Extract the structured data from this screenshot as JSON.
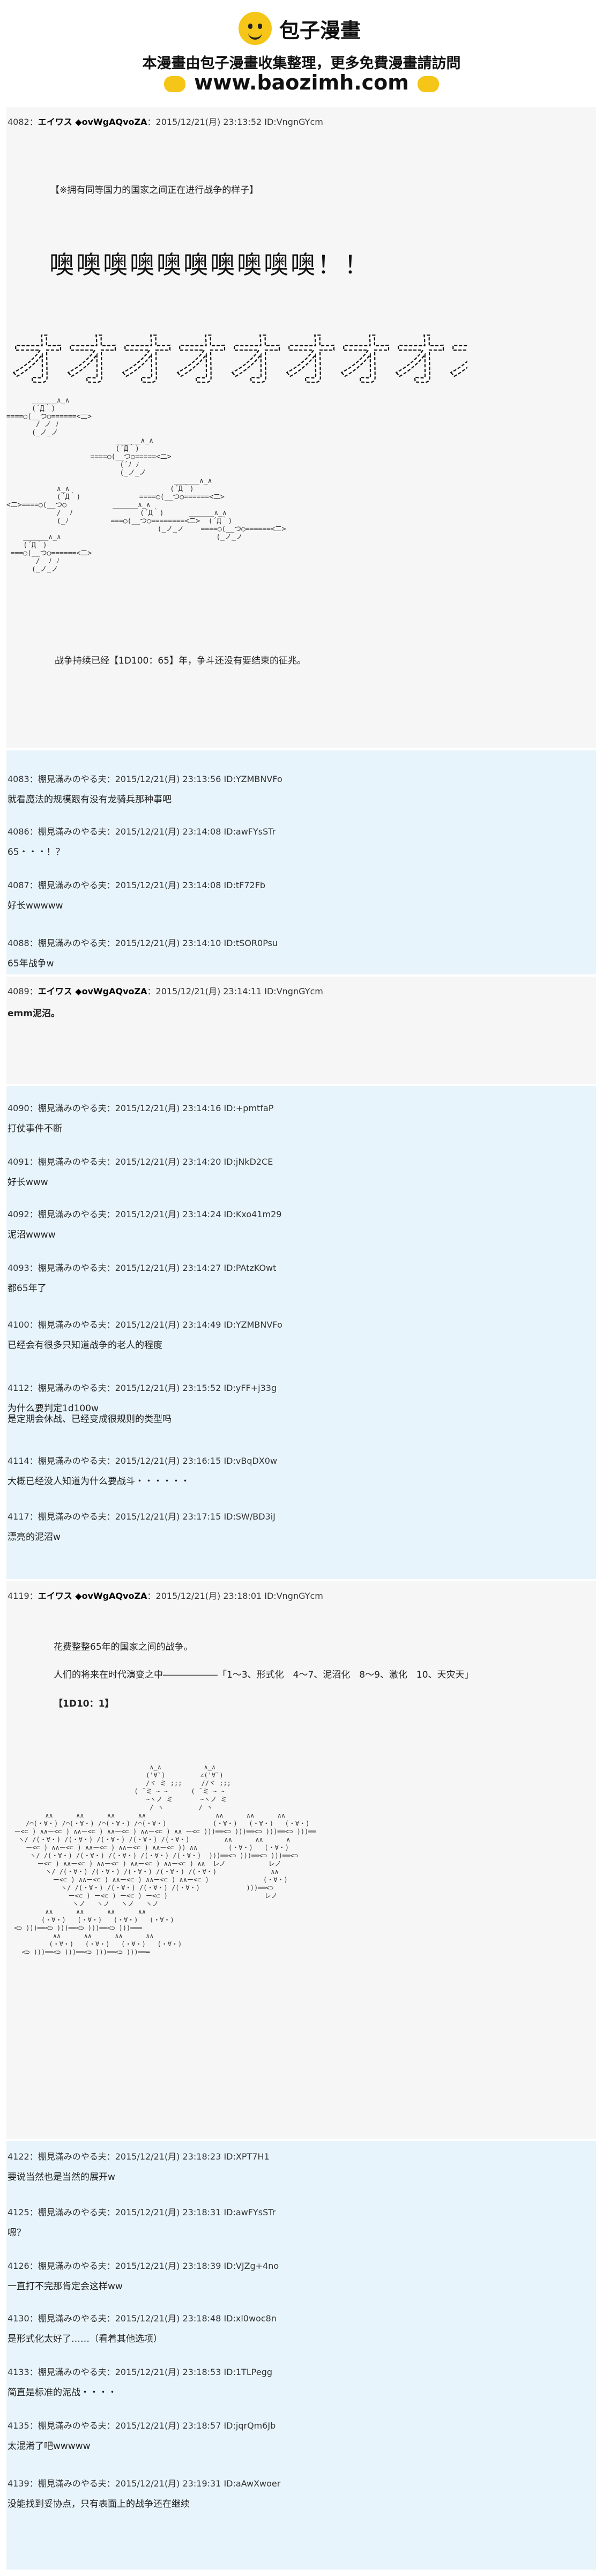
{
  "header": {
    "logo_text": "包子漫畫",
    "tagline": "本漫畫由包子漫畫收集整理，更多免費漫畫請訪問",
    "url": "www.baozimh.com"
  },
  "post4082": {
    "num": "4082",
    "name": "エイワス ◆ovWgAQvoZA",
    "meta_rest": "：2015/12/21(月) 23:13:52 ID:VngnGYcm",
    "line1": "【※拥有同等国力的国家之间正在进行战争的样子】",
    "big": "噢噢噢噢噢噢噢噢噢噢！！",
    "katakana": "オオオオオオオオオオ!!",
    "line_last": "战争持续已经【1D100：65】年，争斗还没有要结束的征兆。"
  },
  "aa1": [
    "      ______∧_∧",
    "      (´Д｀)",
    "====○(__つ○======<二>",
    "       / ノ ﾉ",
    "      (_ノ_ノ",
    "                          ______∧_∧",
    "                          (´Д｀)",
    "                    ====○(__つ○=====<二>",
    "                           (´ﾉ ﾉ",
    "                           (_ノ_ノ",
    "                                        ______∧_∧",
    "            ∧_∧                        (´Д｀)",
    "            (´Д｀)              ====○(__つ○======<二>",
    "<二>====○(__つ○           ______∧_∧",
    "            /  ﾉ                (´Д｀)      ______∧_∧",
    "            (_ﾉ          ===○(__つ○========<二>  (´Д｀)",
    "                                    (_ノ_ノ    ====○(__つ○======<二>",
    "    ______∧_∧                                     (_ノ_ノ",
    "    (´Д｀)",
    " ===○(__つ○======<二>",
    "       /  ﾉ ﾉ",
    "      (_ノ_ノ"
  ],
  "posts_a": [
    {
      "num": "4083",
      "meta": "：棚見滿みのやる夫：2015/12/21(月) 23:13:56 ID:YZMBNVFo",
      "text": "就看魔法的规模跟有没有龙骑兵那种事吧"
    },
    {
      "num": "4086",
      "meta": "：棚見滿みのやる夫：2015/12/21(月) 23:14:08 ID:awFYsSTr",
      "text": "65・・・！？"
    },
    {
      "num": "4087",
      "meta": "：棚見滿みのやる夫：2015/12/21(月) 23:14:08 ID:tF72Fb",
      "text": "好长wwwww"
    },
    {
      "num": "4088",
      "meta": "：棚見滿みのやる夫：2015/12/21(月) 23:14:10 ID:tSOR0Psu",
      "text": "65年战争w"
    }
  ],
  "post4089": {
    "num": "4089",
    "name": "エイワス ◆ovWgAQvoZA",
    "meta_rest": "：2015/12/21(月) 23:14:11 ID:VngnGYcm",
    "text": "emm泥沼。"
  },
  "posts_b": [
    {
      "num": "4090",
      "meta": "：棚見滿みのやる夫：2015/12/21(月) 23:14:16 ID:+pmtfaP",
      "text": "打仗事件不断"
    },
    {
      "num": "4091",
      "meta": "：棚見滿みのやる夫：2015/12/21(月) 23:14:20 ID:jNkD2CE",
      "text": "好长www"
    },
    {
      "num": "4092",
      "meta": "：棚見滿みのやる夫：2015/12/21(月) 23:14:24 ID:Kxo41m29",
      "text": "泥沼wwww"
    },
    {
      "num": "4093",
      "meta": "：棚見滿みのやる夫：2015/12/21(月) 23:14:27 ID:PAtzKOwt",
      "text": "都65年了"
    },
    {
      "num": "4100",
      "meta": "：棚見滿みのやる夫：2015/12/21(月) 23:14:49 ID:YZMBNVFo",
      "text": "已经会有很多只知道战争的老人的程度"
    },
    {
      "num": "4112",
      "meta": "：棚見滿みのやる夫：2015/12/21(月) 23:15:52 ID:yFF+j33g",
      "text": "为什么要判定1d100w\n是定期会休战、已经变成很规则的类型吗"
    },
    {
      "num": "4114",
      "meta": "：棚見滿みのやる夫：2015/12/21(月) 23:16:15 ID:vBqDX0w",
      "text": "大概已经没人知道为什么要战斗・・・・・・"
    },
    {
      "num": "4117",
      "meta": "：棚見滿みのやる夫：2015/12/21(月) 23:17:15 ID:SW/BD3iJ",
      "text": "漂亮的泥沼w"
    }
  ],
  "post4119": {
    "num": "4119",
    "name": "エイワス ◆ovWgAQvoZA",
    "meta_rest": "：2015/12/21(月) 23:18:01 ID:VngnGYcm",
    "line1": "花费整整65年的国家之间的战争。",
    "line2": "人们的将来在时代演变之中――――――「1～3、形式化　4～7、泥沼化　8～9、激化　10、天灾天」",
    "line3": "【1D10：1】"
  },
  "aa2": [
    "                                     ∧_∧           ∧_∧",
    "                                    ('∀`)         ∠('∀`)",
    "                                    /ヾ ミ ;;;     //ヾ ;;;",
    "                                 ( ̄ ミ ~ ~      ( ̄ ミ ~ ~",
    "                                    ~ヽノ ミ       ~ヽノ ミ",
    "                                     / ヽ         / ヽ",
    "          ∧∧      ∧∧      ∧∧      ∧∧                  ∧∧      ∧∧      ∧∧",
    "     /⌒(・∀・) /⌒(・∀・) /⌒(・∀・) /⌒(・∀・)            (・∀・)   (・∀・)   (・∀・)",
    "  ー<⊂ ) ∧∧ー<⊂ ) ∧∧ー<⊂ ) ∧∧ー<⊂ ) ∧∧ー<⊂ ) ∧∧ ー<⊂ )))══<⊃ )))══<⊃ )))══<⊃ )))══",
    "   ヽ/ /(・∀・) /(・∀・) /(・∀・) /(・∀・) /(・∀・)         ∧∧      ∧∧      ∧",
    "     ー<⊂ ) ∧∧ー<⊂ ) ∧∧ー<⊂ ) ∧∧ー<⊂ ) ∧∧ー<⊂ )) ∧∧        (・∀・)   (・∀・)",
    "      ヽ/ /(・∀・) /(・∀・) /(・∀・) /(・∀・) /(・∀・)  )))══<⊃ )))══<⊃ )))══<⊃",
    "        ー<⊂ ) ∧∧ー<⊂ ) ∧∧ー<⊂ ) ∧∧ー<⊂ ) ∧∧ー<⊂ ) ∧∧  レノ           レノ",
    "          ヽ/ /(・∀・) /(・∀・) /(・∀・) /(・∀・) /(・∀・)              ∧∧",
    "            ー<⊂ ) ∧∧ー<⊂ ) ∧∧ー<⊂ ) ∧∧ー<⊂ ) ∧∧ー<⊂ )              (・∀・)",
    "              ヽ/ /(・∀・) /(・∀・) /(・∀・) /(・∀・)            )))══<⊃",
    "                ー<⊂ ) ー<⊂ ) ー<⊂ ) ー<⊂ )                         レノ",
    "                 ヽノ   ヽノ   ヽノ   ヽノ",
    "          ∧∧      ∧∧      ∧∧      ∧∧",
    "         (・∀・)   (・∀・)   (・∀・)   (・∀・)",
    "  <⊃ )))══<⊃ )))══<⊃ )))══<⊃ )))═══",
    "            ∧∧      ∧∧      ∧∧      ∧∧",
    "           (・∀・)   (・∀・)   (・∀・)   (・∀・)",
    "    <⊃ )))══<⊃ )))══<⊃ )))══<⊃ )))══━"
  ],
  "posts_c": [
    {
      "num": "4122",
      "meta": "：棚見滿みのやる夫：2015/12/21(月) 23:18:23 ID:XPT7H1",
      "text": "要说当然也是当然的展开w"
    },
    {
      "num": "4125",
      "meta": "：棚見滿みのやる夫：2015/12/21(月) 23:18:31 ID:awFYsSTr",
      "text": "嗯？"
    },
    {
      "num": "4126",
      "meta": "：棚見滿みのやる夫：2015/12/21(月) 23:18:39 ID:VJZg+4no",
      "text": "一直打不完那肯定会这样ww"
    },
    {
      "num": "4130",
      "meta": "：棚見滿みのやる夫：2015/12/21(月) 23:18:48 ID:xl0woc8n",
      "text": "是形式化太好了……（看着其他选项）"
    },
    {
      "num": "4133",
      "meta": "：棚見滿みのやる夫：2015/12/21(月) 23:18:53 ID:1TLPegg",
      "text": "简直是标准的泥战・・・・"
    },
    {
      "num": "4135",
      "meta": "：棚見滿みのやる夫：2015/12/21(月) 23:18:57 ID:jqrQm6Jb",
      "text": "太混淆了吧wwwww"
    },
    {
      "num": "4139",
      "meta": "：棚見滿みのやる夫：2015/12/21(月) 23:19:31 ID:aAwXwoer",
      "text": "没能找到妥协点，只有表面上的战争还在继续"
    }
  ]
}
